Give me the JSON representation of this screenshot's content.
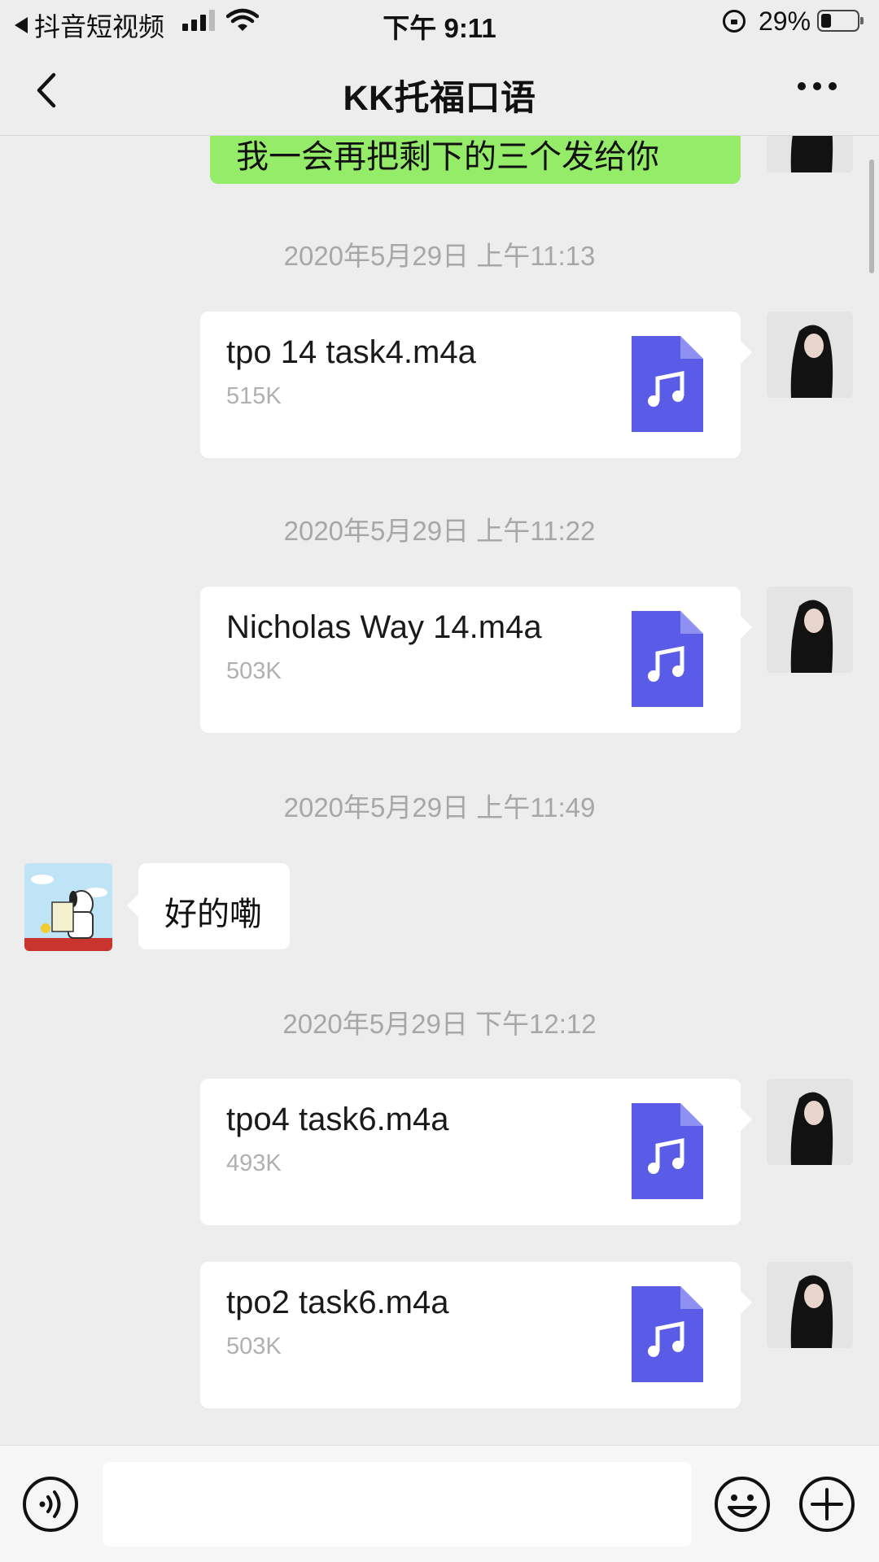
{
  "status_bar": {
    "back_app": "抖音短视频",
    "time": "下午 9:11",
    "battery": "29%",
    "battery_level": 0.29
  },
  "nav": {
    "title": "KK托福口语",
    "back_icon": "chevron-left-icon",
    "more_icon": "ellipsis-icon"
  },
  "chat": {
    "partial_message": "我一会再把剩下的三个发给你",
    "timestamps": [
      "2020年5月29日 上午11:13",
      "2020年5月29日 上午11:22",
      "2020年5月29日 上午11:49",
      "2020年5月29日 下午12:12"
    ],
    "files": [
      {
        "name": "tpo 14 task4.m4a",
        "size": "515K"
      },
      {
        "name": "Nicholas Way 14.m4a",
        "size": "503K"
      },
      {
        "name": "tpo4 task6.m4a",
        "size": "493K"
      },
      {
        "name": "tpo2 task6.m4a",
        "size": "503K"
      }
    ],
    "reply": "好的嘞"
  },
  "input_bar": {
    "voice_icon": "voice-icon",
    "emoji_icon": "emoji-icon",
    "plus_icon": "plus-icon",
    "text_value": ""
  },
  "colors": {
    "background": "#ededed",
    "sent_bubble": "#95ec69",
    "file_icon": "#5a5ce8",
    "timestamp": "#a7a7a7"
  }
}
